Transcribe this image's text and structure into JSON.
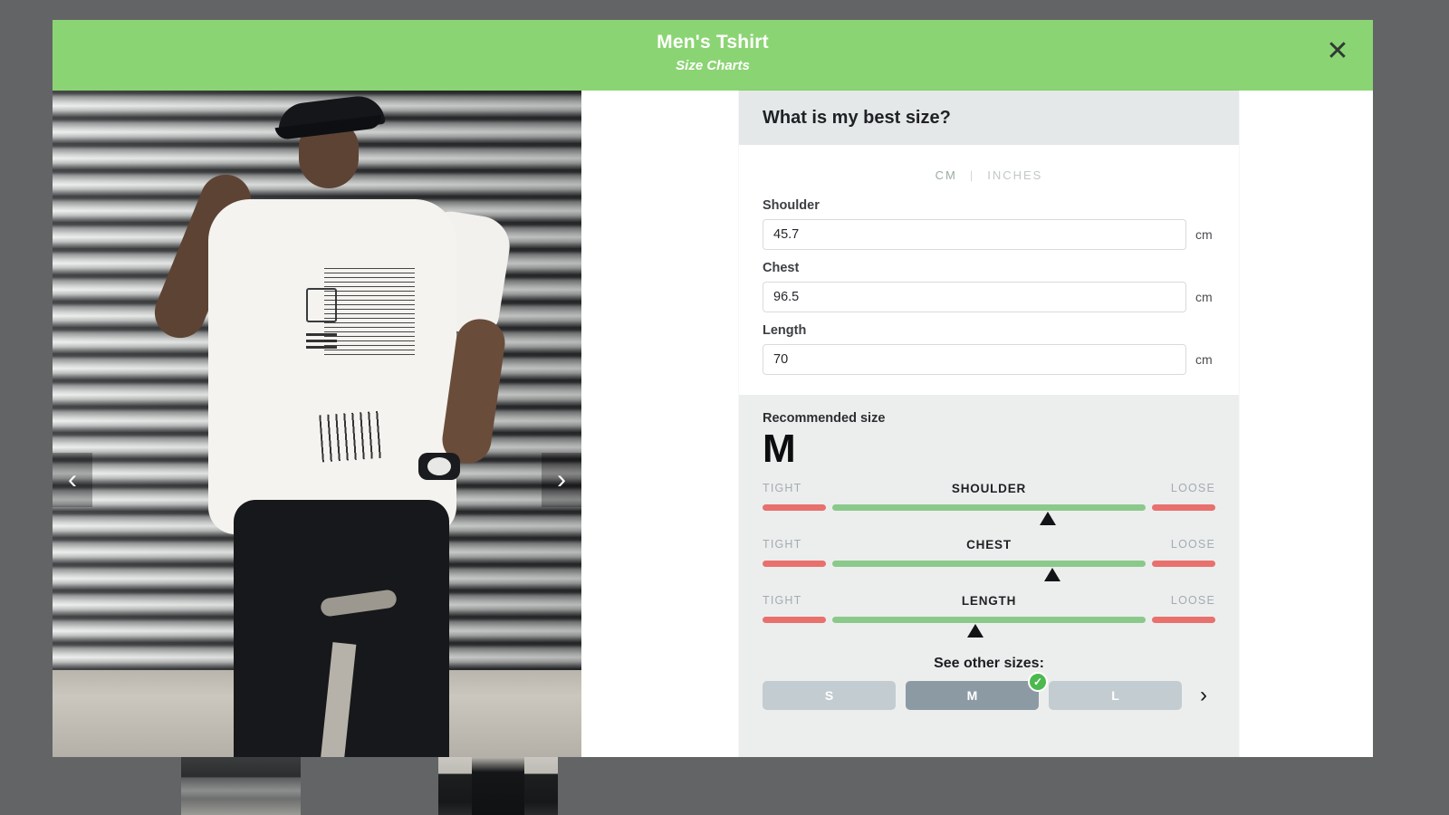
{
  "theme": {
    "header_green": "#8bd473",
    "backdrop_gray": "#636466",
    "panel_gray": "#eceeee",
    "panel_header_gray": "#e4e8e8",
    "fit_good_green": "#8bc98a",
    "fit_bad_red": "#e8706d",
    "check_green": "#4cb94f",
    "chip_gray": "#c3ccd1",
    "chip_selected_gray": "#8c9aa4"
  },
  "modal": {
    "title": "Men's Tshirt",
    "subtitle": "Size Charts",
    "close_icon": "close-icon",
    "close_label": "✕"
  },
  "gallery": {
    "prev_label": "‹",
    "next_label": "›",
    "prev_icon": "chevron-left-icon",
    "next_icon": "chevron-right-icon"
  },
  "panel": {
    "title": "What is my best size?"
  },
  "units": {
    "cm": "CM",
    "separator": "|",
    "inches": "INCHES",
    "active": "CM"
  },
  "measurements": [
    {
      "label": "Shoulder",
      "value": "45.7",
      "unit": "cm",
      "placeholder": ""
    },
    {
      "label": "Chest",
      "value": "96.5",
      "unit": "cm",
      "placeholder": ""
    },
    {
      "label": "Length",
      "value": "70",
      "unit": "cm",
      "placeholder": ""
    }
  ],
  "recommendation": {
    "label": "Recommended size",
    "size": "M"
  },
  "fit_scales": [
    {
      "name": "SHOULDER",
      "tight": "TIGHT",
      "loose": "LOOSE",
      "marker_percent": 63
    },
    {
      "name": "CHEST",
      "tight": "TIGHT",
      "loose": "LOOSE",
      "marker_percent": 64
    },
    {
      "name": "LENGTH",
      "tight": "TIGHT",
      "loose": "LOOSE",
      "marker_percent": 47
    }
  ],
  "other_sizes": {
    "label": "See other sizes:",
    "next_label": "›",
    "items": [
      {
        "label": "S",
        "selected": false
      },
      {
        "label": "M",
        "selected": true
      },
      {
        "label": "L",
        "selected": false
      }
    ],
    "check_glyph": "✓"
  }
}
